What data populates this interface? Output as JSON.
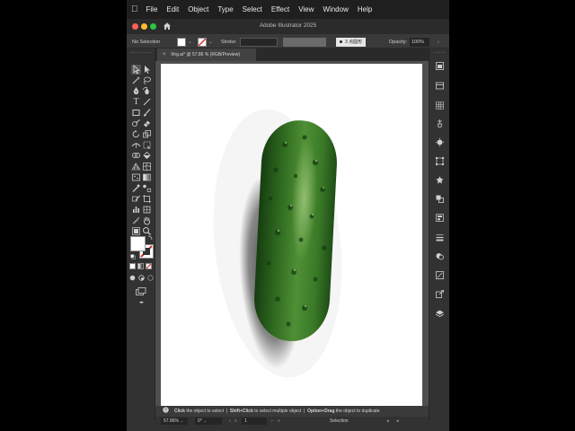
{
  "menubar": {
    "items": [
      "File",
      "Edit",
      "Object",
      "Type",
      "Select",
      "Effect",
      "View",
      "Window",
      "Help"
    ]
  },
  "titlebar": {
    "app_title": "Adobe Illustrator 2025",
    "traffic_lights": [
      "#ff5f57",
      "#febc2e",
      "#28c840"
    ]
  },
  "controlbar": {
    "selection_label": "No Selection",
    "stroke_label": "Stroke:",
    "brush_label": "3 点圆形",
    "opacity_label": "Opacity:",
    "opacity_value": "100%"
  },
  "document": {
    "tab_label": "hhg.ai* @ 57.86 % (RGB/Preview)",
    "close_glyph": "×"
  },
  "statusbar": {
    "parts": [
      {
        "text": "Click",
        "bold": true
      },
      {
        "text": " the object to select  |  ",
        "bold": false
      },
      {
        "text": "Shift+Click",
        "bold": true
      },
      {
        "text": " to select multiple object  |  ",
        "bold": false
      },
      {
        "text": "Option+Drag",
        "bold": true
      },
      {
        "text": " the object to duplicate",
        "bold": false
      }
    ]
  },
  "bottombar": {
    "zoom": "57.86%",
    "rotation": "0°",
    "artboard_number": "1",
    "mode": "Selection"
  },
  "toolbar": {
    "more_glyph": "•••"
  },
  "colors": {
    "fill": "#ffffff",
    "stroke_none": "#d62b2b",
    "cucumber_dark": "#1f4d17",
    "cucumber_light": "#4f8f35"
  }
}
